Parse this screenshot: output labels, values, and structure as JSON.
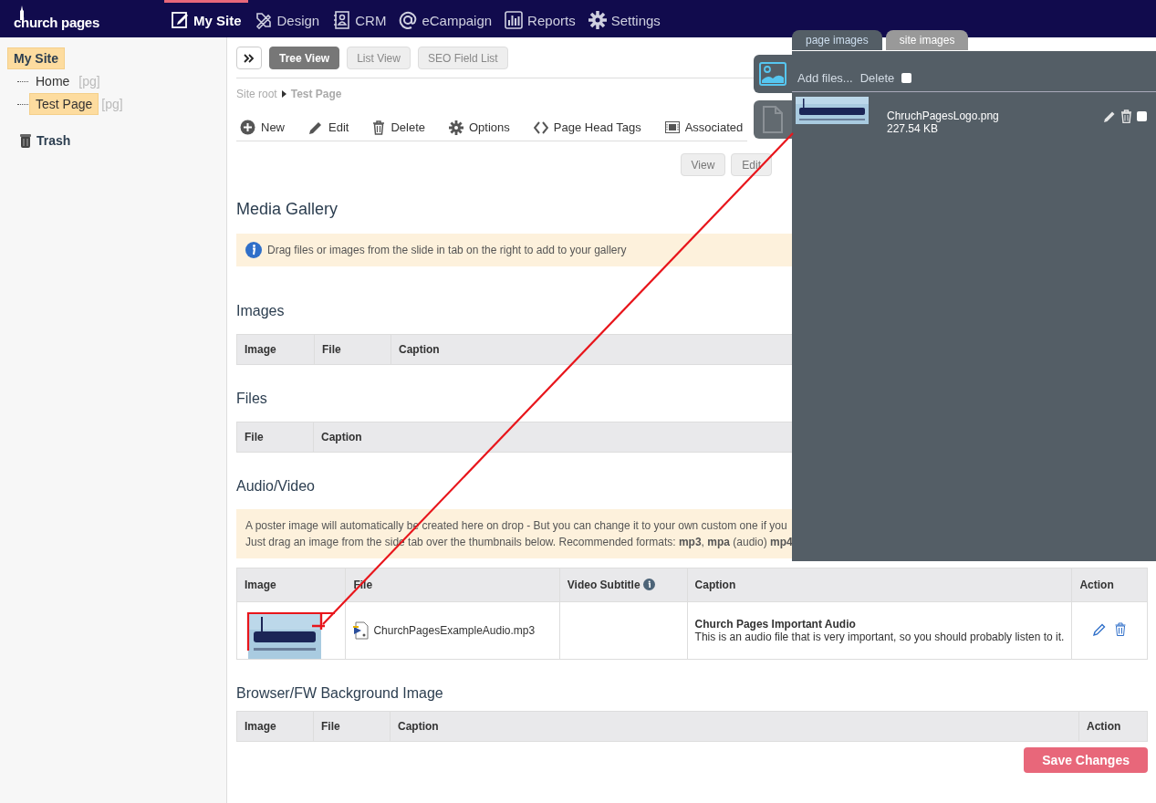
{
  "brand": {
    "name": "church pages"
  },
  "nav": [
    {
      "label": "My Site",
      "selected": true
    },
    {
      "label": "Design",
      "selected": false
    },
    {
      "label": "CRM",
      "selected": false
    },
    {
      "label": "eCampaign",
      "selected": false
    },
    {
      "label": "Reports",
      "selected": false
    },
    {
      "label": "Settings",
      "selected": false
    }
  ],
  "sidebar": {
    "tree": [
      {
        "label": "My Site",
        "selected": true,
        "children": [
          {
            "label": "Home",
            "tag": "[pg]",
            "selected": false
          },
          {
            "label": "Test Page",
            "tag": "[pg]",
            "selected": true
          }
        ]
      }
    ],
    "trash": "Trash"
  },
  "view_tabs": [
    {
      "label": "Tree View",
      "selected": true
    },
    {
      "label": "List View",
      "selected": false
    },
    {
      "label": "SEO Field List",
      "selected": false
    }
  ],
  "breadcrumb": [
    "Site root",
    "Test Page"
  ],
  "actions": [
    "New",
    "Edit",
    "Delete",
    "Options",
    "Page Head Tags",
    "Associated"
  ],
  "page_buttons": [
    "View",
    "Edit"
  ],
  "gallery": {
    "title": "Media Gallery",
    "info": "Drag files or images from the slide in tab on the right to add to your gallery",
    "sections": [
      {
        "title": "Images",
        "columns": [
          {
            "label": "Image"
          },
          {
            "label": "File"
          },
          {
            "label": "Caption"
          }
        ]
      },
      {
        "title": "Files",
        "columns": [
          {
            "label": "File"
          },
          {
            "label": "Caption"
          }
        ]
      },
      {
        "title": "Audio/Video",
        "hint": [
          "A poster image will automatically be created here on drop - But you can change it to your own custom one if you",
          "Just drag an image from the side tab over the thumbnails below. Recommended formats: **mp3**, **mpa** (audio) **mp4**"
        ],
        "columns": [
          {
            "label": "Image"
          },
          {
            "label": "File"
          },
          {
            "label": "Video Subtitle",
            "info": true
          },
          {
            "label": "Caption"
          },
          {
            "label": "Action"
          }
        ],
        "rows": [
          {
            "file": "ChurchPagesExampleAudio.mp3",
            "caption_title": "Church Pages Important Audio",
            "caption": "This is an audio file that is very important, so you should probably listen to it."
          }
        ]
      },
      {
        "title": "Browser/FW Background Image",
        "columns": [
          {
            "label": "Image"
          },
          {
            "label": "File"
          },
          {
            "label": "Caption"
          },
          {
            "label": "Action"
          }
        ]
      }
    ]
  },
  "save": "Save Changes",
  "panel": {
    "tabs": [
      {
        "label": "page images",
        "selected": true
      },
      {
        "label": "site images",
        "selected": false
      }
    ],
    "side_tabs": [
      {
        "selected": true
      },
      {
        "selected": false
      }
    ],
    "add_files": "Add files...",
    "delete": "Delete",
    "delete_checked": false,
    "files": [
      {
        "name": "ChruchPagesLogo.png",
        "size": "227.54 KB",
        "checked": false
      }
    ]
  }
}
